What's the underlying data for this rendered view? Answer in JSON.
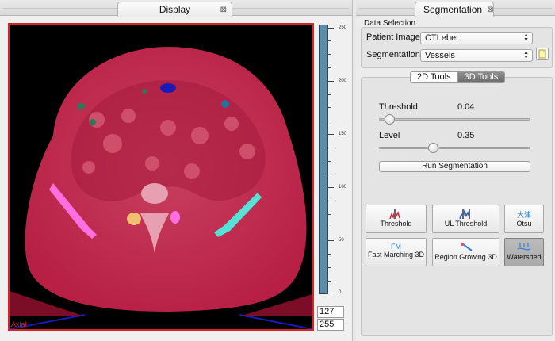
{
  "display": {
    "tab_title": "Display",
    "view_label": "Axial",
    "scale_ticks": [
      "250",
      "200",
      "150",
      "100",
      "50",
      "0"
    ],
    "window_min": "127",
    "window_max": "255"
  },
  "segmentation": {
    "tab_title": "Segmentation",
    "data_selection_title": "Data Selection",
    "patient_image_label": "Patient Image",
    "patient_image_value": "CTLeber",
    "segmentation_label": "Segmentation",
    "segmentation_value": "Vessels",
    "tool_tabs": [
      "2D Tools",
      "3D Tools"
    ],
    "active_tool_tab": "3D Tools",
    "threshold": {
      "label": "Threshold",
      "value": "0.04",
      "slider_fraction": 0.04
    },
    "level": {
      "label": "Level",
      "value": "0.35",
      "slider_fraction": 0.35
    },
    "run_button": "Run Segmentation",
    "tools": [
      {
        "label": "Threshold",
        "icon": "histogram-threshold-icon"
      },
      {
        "label": "UL Threshold",
        "icon": "histogram-ul-threshold-icon"
      },
      {
        "label": "Otsu",
        "icon": "otsu-icon",
        "glyph": "大津"
      },
      {
        "label": "Fast Marching 3D",
        "icon": "fast-marching-icon",
        "glyph": "FM"
      },
      {
        "label": "Region Growing 3D",
        "icon": "region-growing-icon"
      },
      {
        "label": "Watershed",
        "icon": "watershed-icon"
      }
    ],
    "selected_tool": "Watershed"
  },
  "colors": {
    "viewer_border": "#d62424",
    "overlay": "#c8284a",
    "accent_blue": "#2b7fd8",
    "magenta_label": "#ff6fe0",
    "cyan_label": "#55e3d8"
  }
}
